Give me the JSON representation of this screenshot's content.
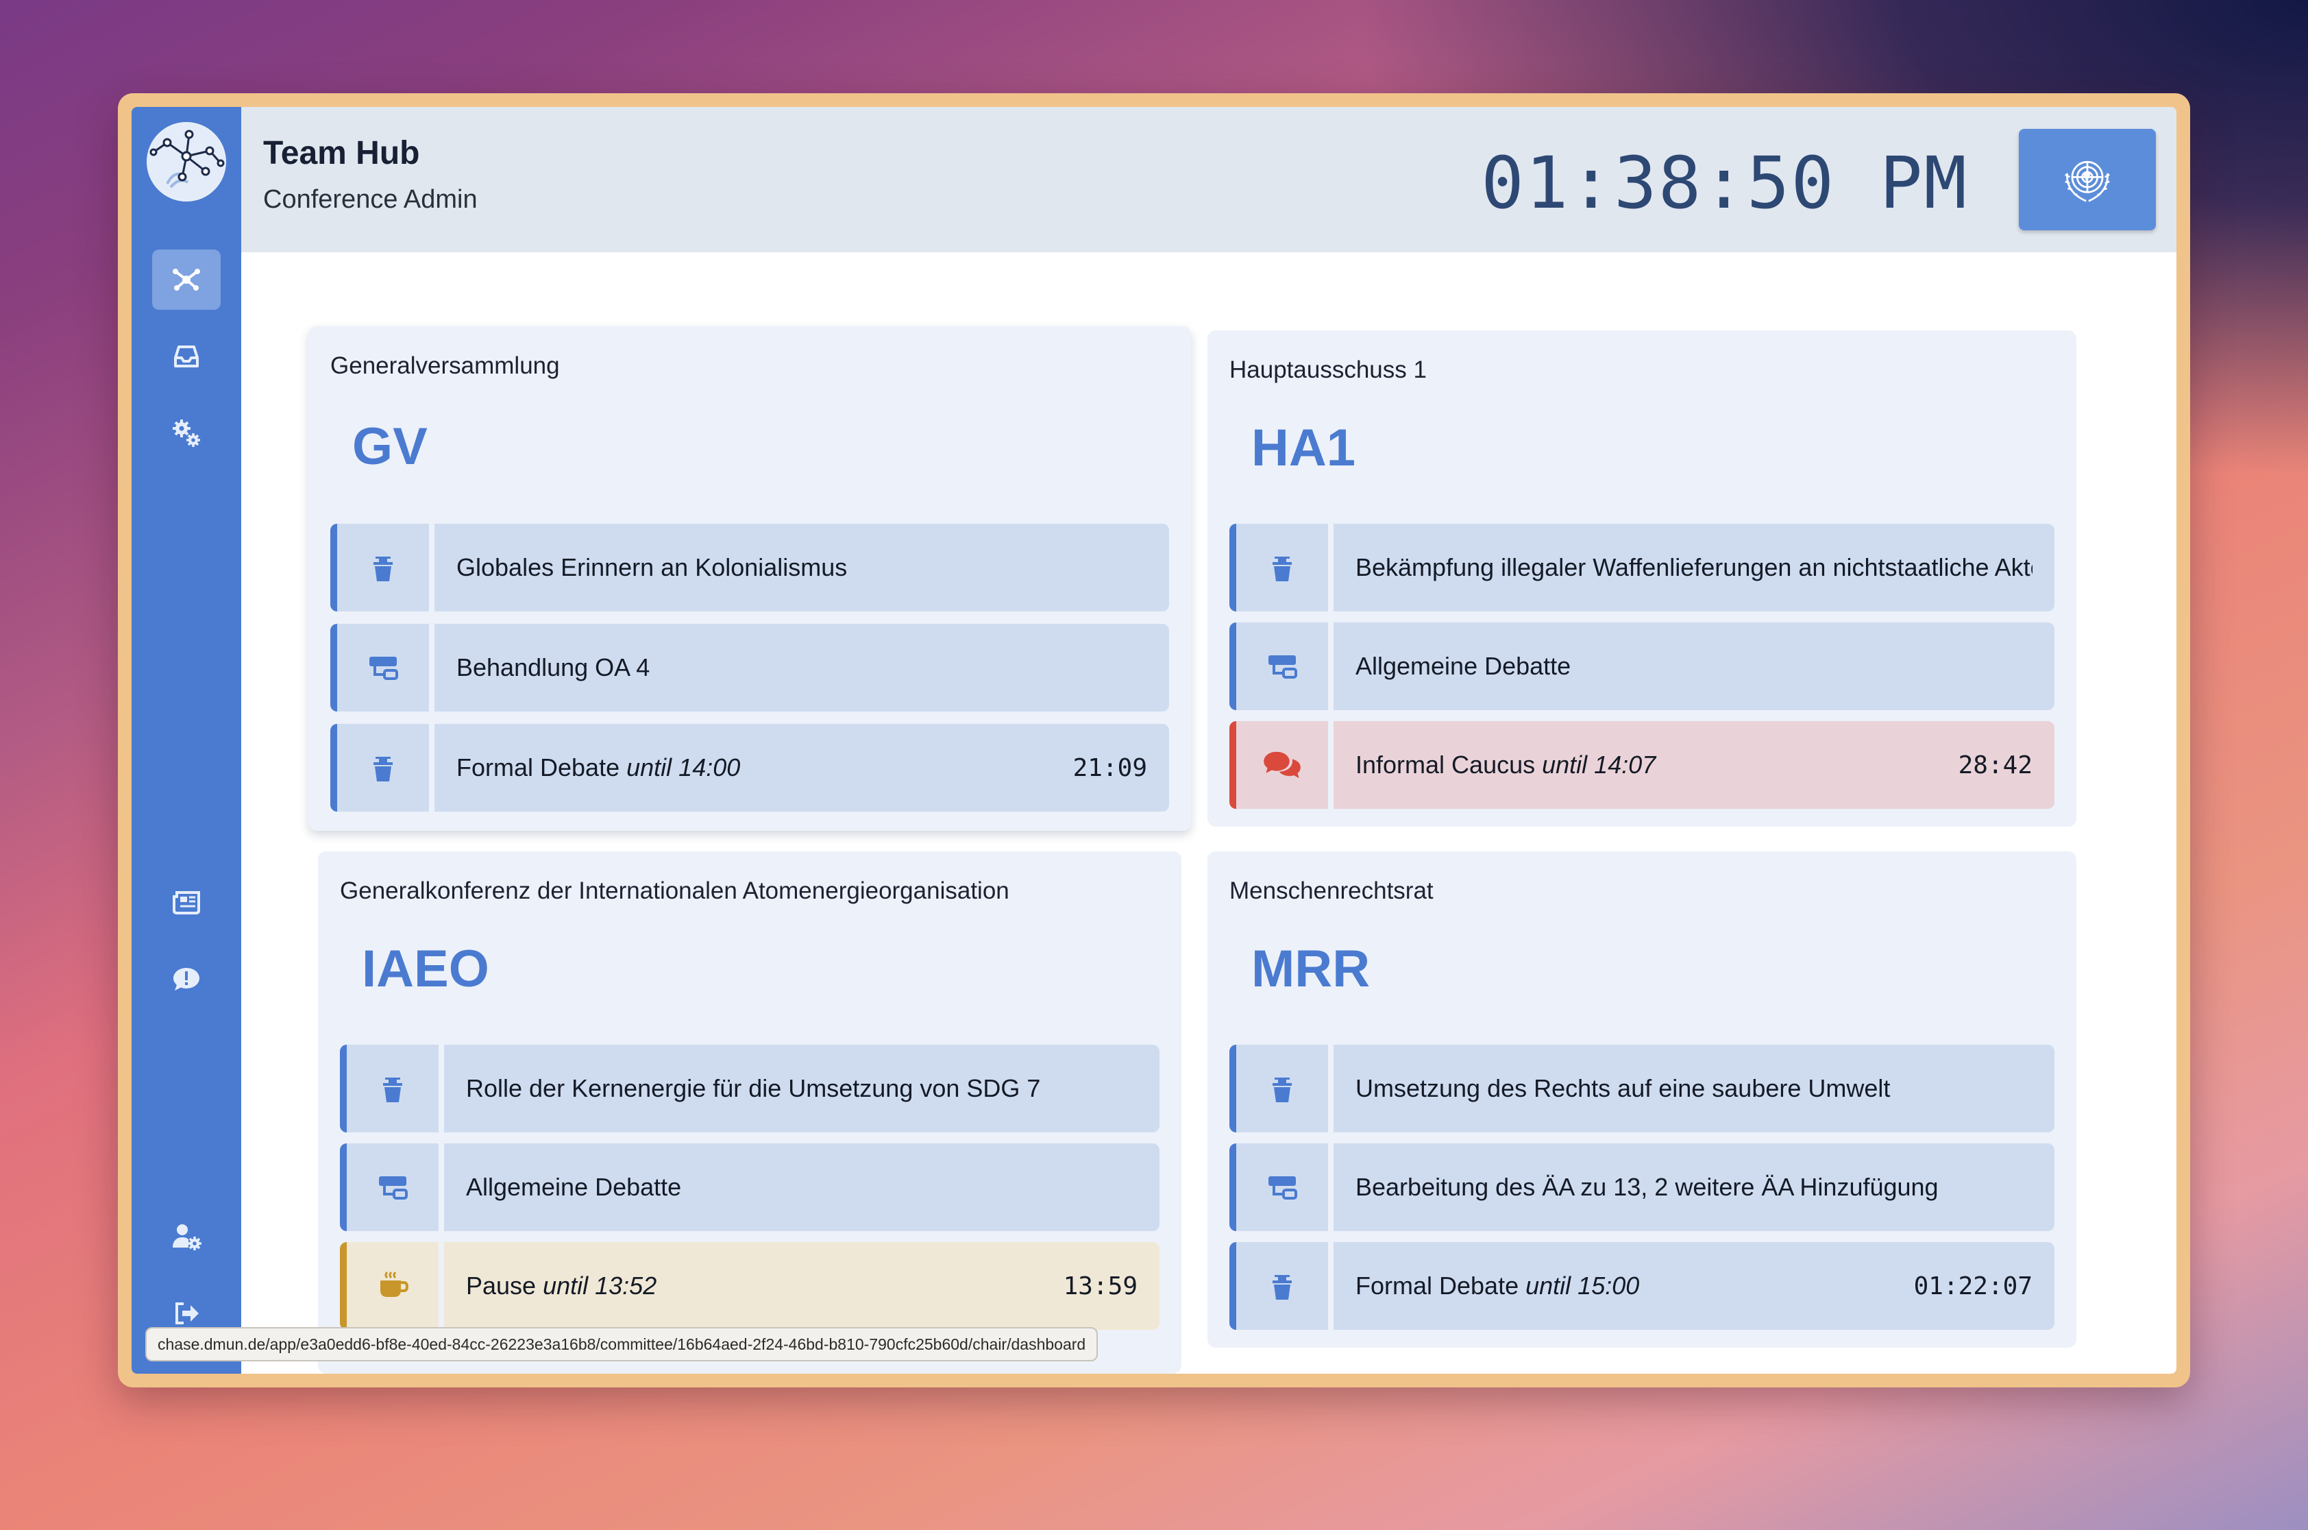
{
  "app": {
    "title": "Team Hub",
    "subtitle": "Conference Admin",
    "clock": "01:38:50 PM"
  },
  "sidebar": {
    "items": [
      {
        "icon": "network-icon",
        "active": true
      },
      {
        "icon": "inbox-icon"
      },
      {
        "icon": "settings-gears-icon"
      },
      {
        "icon": "newspaper-icon"
      },
      {
        "icon": "comment-alert-icon"
      },
      {
        "icon": "user-settings-icon"
      },
      {
        "icon": "logout-icon"
      }
    ]
  },
  "committees": [
    {
      "name": "Generalversammlung",
      "abbr": "GV",
      "topic": "Globales Erinnern an Kolonialismus",
      "agenda": "Behandlung OA 4",
      "status": {
        "label": "Formal Debate",
        "until": "until 14:00",
        "timer": "21:09",
        "kind": "formal"
      }
    },
    {
      "name": "Hauptausschuss 1",
      "abbr": "HA1",
      "topic": "Bekämpfung illegaler Waffenlieferungen an nichtstaatliche Akteu",
      "agenda": "Allgemeine Debatte",
      "status": {
        "label": "Informal Caucus",
        "until": "until 14:07",
        "timer": "28:42",
        "kind": "informal"
      }
    },
    {
      "name": "Generalkonferenz der Internationalen Atomenergieorganisation",
      "abbr": "IAEO",
      "topic": "Rolle der Kernenergie für die Umsetzung von SDG 7",
      "agenda": "Allgemeine Debatte",
      "status": {
        "label": "Pause",
        "until": "until 13:52",
        "timer": "13:59",
        "kind": "pause"
      }
    },
    {
      "name": "Menschenrechtsrat",
      "abbr": "MRR",
      "topic": "Umsetzung des Rechts auf eine saubere Umwelt",
      "agenda": "Bearbeitung des ÄA zu 13, 2 weitere ÄA Hinzufügung",
      "status": {
        "label": "Formal Debate",
        "until": "until 15:00",
        "timer": "01:22:07",
        "kind": "formal"
      }
    }
  ],
  "status_bar": {
    "url": "chase.dmun.de/app/e3a0edd6-bf8e-40ed-84cc-26223e3a16b8/committee/16b64aed-2f24-46bd-b810-790cfc25b60d/chair/dashboard"
  },
  "colors": {
    "sidebar": "#4a7bd0",
    "accent": "#4a7bd0",
    "informal": "#d94a3d",
    "pause": "#c8962a"
  }
}
